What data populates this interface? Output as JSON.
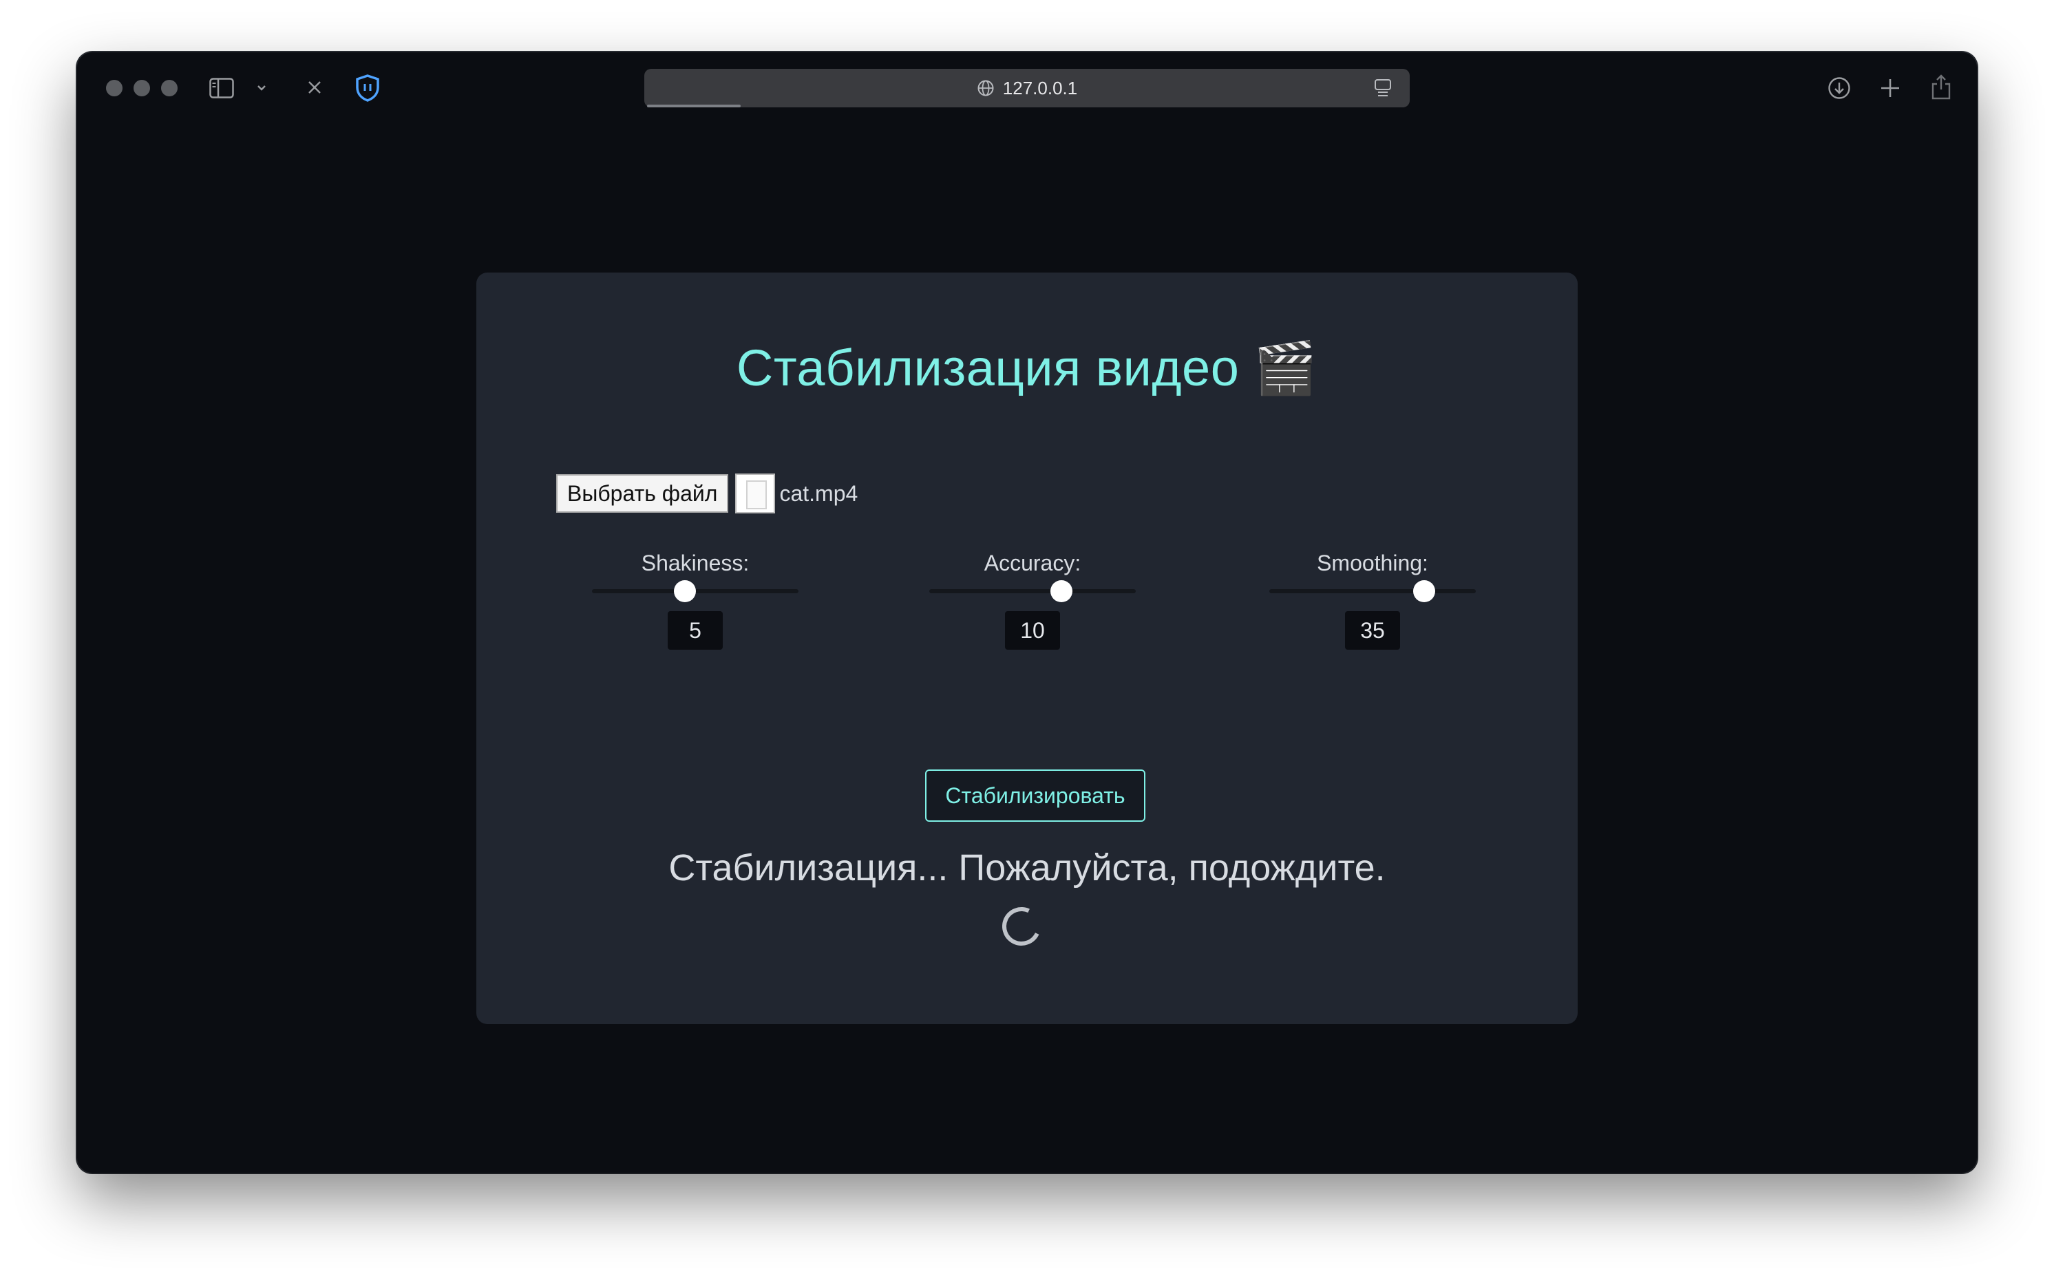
{
  "browser": {
    "url": "127.0.0.1"
  },
  "app": {
    "title": "Стабилизация видео 🎬",
    "file_button_label": "Выбрать файл",
    "file_name": "cat.mp4",
    "sliders": [
      {
        "label": "Shakiness:",
        "value": "5",
        "fraction": 0.45
      },
      {
        "label": "Accuracy:",
        "value": "10",
        "fraction": 0.64
      },
      {
        "label": "Smoothing:",
        "value": "35",
        "fraction": 0.75
      }
    ],
    "stabilize_button": "Стабилизировать",
    "status_text": "Стабилизация... Пожалуйста, подождите."
  },
  "colors": {
    "accent": "#7ff0e6",
    "card": "#212630",
    "background": "#0b0d12"
  }
}
